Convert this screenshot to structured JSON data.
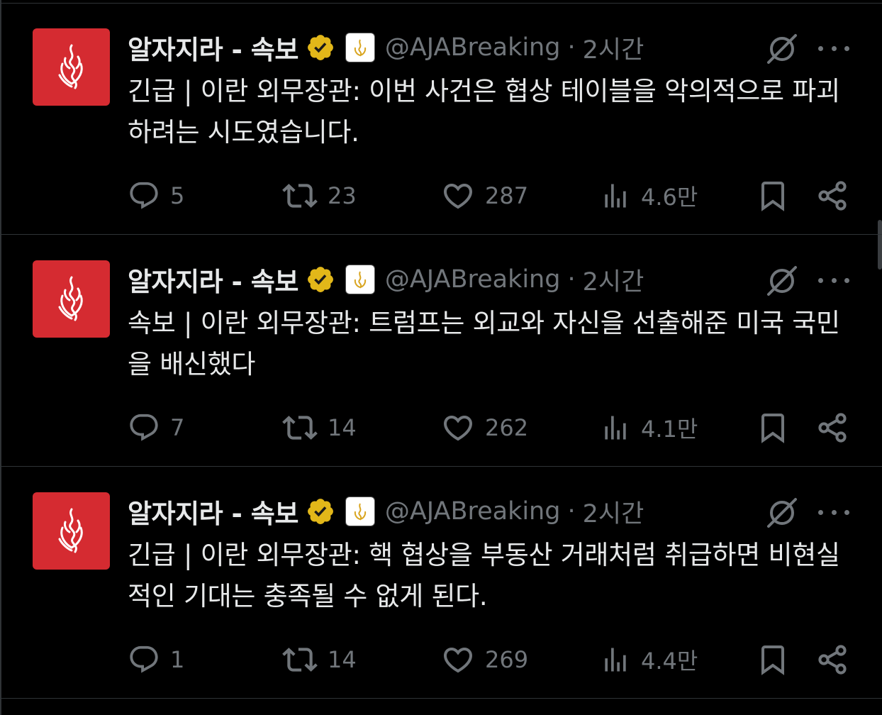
{
  "colors": {
    "background": "#000000",
    "text": "#e7e9ea",
    "muted": "#71767b",
    "avatar": "#d52b31",
    "verified": "#e2b719"
  },
  "tweets": [
    {
      "author": "알자지라 - 속보",
      "handle": "@AJABreaking",
      "separator": "·",
      "time": "2시간",
      "text": "긴급 | 이란 외무장관: 이번 사건은 협상 테이블을 악의적으로 파괴하려는 시도였습니다.",
      "replies": "5",
      "retweets": "23",
      "likes": "287",
      "views": "4.6만",
      "icons": {
        "avatar": "al-jazeera-logo",
        "verified": "verified-badge-icon",
        "affiliation": "affiliation-badge-icon",
        "grok": "grok-icon",
        "more": "more-icon",
        "reply": "reply-icon",
        "retweet": "retweet-icon",
        "like": "like-icon",
        "views": "views-icon",
        "bookmark": "bookmark-icon",
        "share": "share-icon"
      }
    },
    {
      "author": "알자지라 - 속보",
      "handle": "@AJABreaking",
      "separator": "·",
      "time": "2시간",
      "text": "속보 | 이란 외무장관: 트럼프는 외교와 자신을 선출해준 미국 국민을 배신했다",
      "replies": "7",
      "retweets": "14",
      "likes": "262",
      "views": "4.1만"
    },
    {
      "author": "알자지라 - 속보",
      "handle": "@AJABreaking",
      "separator": "·",
      "time": "2시간",
      "text": "긴급 | 이란 외무장관: 핵 협상을 부동산 거래처럼 취급하면 비현실적인 기대는 충족될 수 없게 된다.",
      "replies": "1",
      "retweets": "14",
      "likes": "269",
      "views": "4.4만"
    }
  ]
}
